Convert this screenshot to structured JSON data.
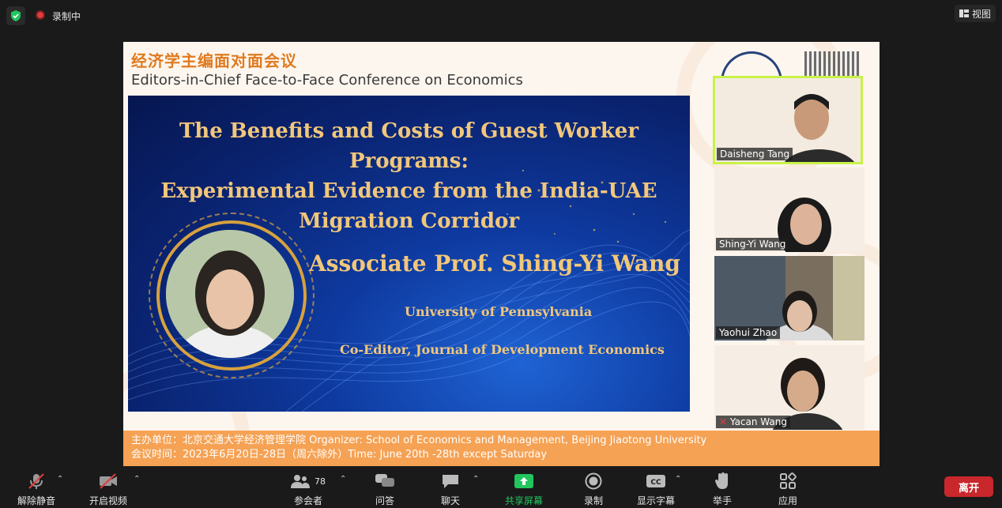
{
  "topbar": {
    "recording_label": "录制中",
    "view_label": "视图"
  },
  "slide": {
    "title_cn": "经济学主编面对面会议",
    "title_en": "Editors-in-Chief Face-to-Face Conference on Economics",
    "talk_title_lines": [
      "The Benefits and Costs of Guest Worker Programs:",
      "Experimental Evidence from the India-UAE",
      "Migration Corridor"
    ],
    "speaker": "Associate Prof. Shing-Yi Wang",
    "university": "University of Pennsylvania",
    "role": "Co-Editor, Journal of Development Economics",
    "footer_line1": "主办单位：北京交通大学经济管理学院 Organizer: School of Economics and Management, Beijing Jiaotong University",
    "footer_line2": "会议时间：2023年6月20日-28日（周六除外）Time: June 20th -28th except Saturday"
  },
  "participants": [
    {
      "name": "Daisheng Tang",
      "active_speaker": true
    },
    {
      "name": "Shing-Yi Wang",
      "active_speaker": false
    },
    {
      "name": "Yaohui Zhao",
      "active_speaker": false
    },
    {
      "name": "Yacan Wang",
      "active_speaker": false,
      "muted": true
    }
  ],
  "toolbar": {
    "unmute_label": "解除静音",
    "start_video_label": "开启视频",
    "participants_label": "参会者",
    "participants_count": "78",
    "qa_label": "问答",
    "chat_label": "聊天",
    "share_label": "共享屏幕",
    "record_label": "录制",
    "captions_label": "显示字幕",
    "raise_hand_label": "举手",
    "apps_label": "应用",
    "leave_label": "离开"
  },
  "colors": {
    "share_green": "#22c55e",
    "leave_red": "#c8272c",
    "active_border": "#c9f24a",
    "footer_orange": "#f5a254",
    "title_gold": "#f2c77a"
  }
}
